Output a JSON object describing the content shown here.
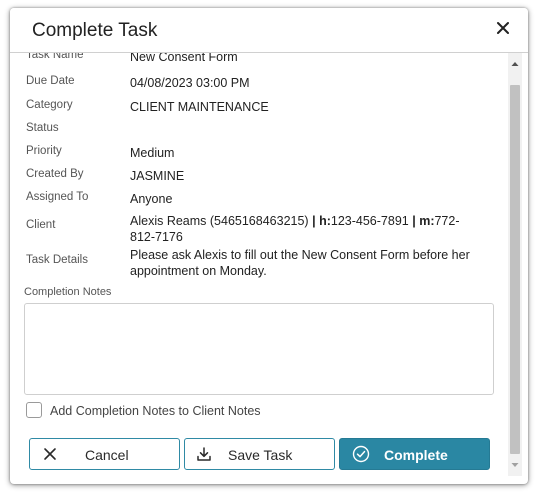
{
  "dialog": {
    "title": "Complete Task"
  },
  "details": [
    {
      "label": "Task Name",
      "value": "New Consent Form"
    },
    {
      "label": "Due Date",
      "value": "04/08/2023 03:00 PM"
    },
    {
      "label": "Category",
      "value": "CLIENT MAINTENANCE"
    },
    {
      "label": "Status",
      "value": ""
    },
    {
      "label": "Priority",
      "value": "Medium"
    },
    {
      "label": "Created By",
      "value": "JASMINE"
    },
    {
      "label": "Assigned To",
      "value": "Anyone"
    },
    {
      "label": "Task Details",
      "value": "Please ask Alexis to fill out the New Consent Form before her appointment on Monday."
    }
  ],
  "client": {
    "label": "Client",
    "name": "Alexis Reams (5465168463215)",
    "sep": "|",
    "home_prefix": "h:",
    "home": "123-456-7891",
    "mobile_prefix": "m:",
    "mobile": "772-812-7176"
  },
  "notes": {
    "label": "Completion Notes",
    "value": ""
  },
  "checkbox": {
    "label": "Add Completion Notes to Client Notes",
    "checked": false
  },
  "buttons": {
    "cancel": "Cancel",
    "save": "Save Task",
    "complete": "Complete"
  },
  "colors": {
    "primary": "#2a87a3",
    "outline": "#2f8aa5"
  },
  "icons": {
    "close": "close-icon",
    "cancel": "x-icon",
    "save": "download-icon",
    "complete": "check-circle-icon"
  }
}
